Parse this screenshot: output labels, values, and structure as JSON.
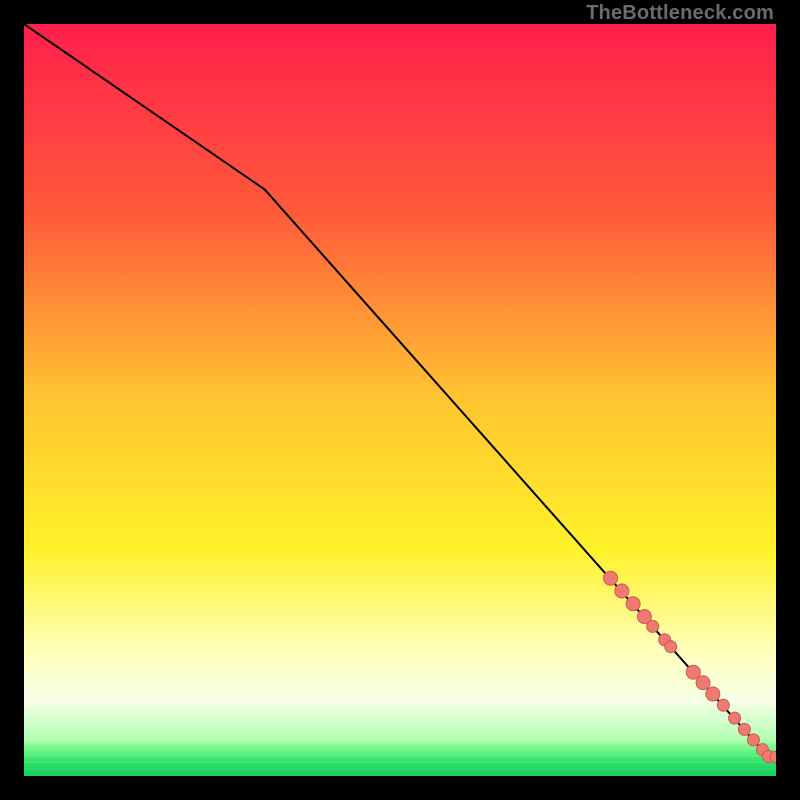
{
  "watermark": "TheBottleneck.com",
  "chart_data": {
    "type": "line",
    "title": "",
    "xlabel": "",
    "ylabel": "",
    "xlim": [
      0,
      100
    ],
    "ylim": [
      0,
      100
    ],
    "grid": false,
    "background_gradient": {
      "stops": [
        {
          "pos": 0.0,
          "color": "#ff1f4c"
        },
        {
          "pos": 0.25,
          "color": "#ff5a3a"
        },
        {
          "pos": 0.5,
          "color": "#ffc531"
        },
        {
          "pos": 0.7,
          "color": "#fff22a"
        },
        {
          "pos": 0.83,
          "color": "#ffffb8"
        },
        {
          "pos": 0.9,
          "color": "#f8ffe8"
        },
        {
          "pos": 0.95,
          "color": "#b4ffb6"
        },
        {
          "pos": 1.0,
          "color": "#00e05a"
        }
      ],
      "green_band": [
        {
          "pos": 0.955,
          "color": "#9cff9e"
        },
        {
          "pos": 0.965,
          "color": "#6cf686"
        },
        {
          "pos": 0.978,
          "color": "#3ce46f"
        },
        {
          "pos": 0.99,
          "color": "#21d862"
        },
        {
          "pos": 1.0,
          "color": "#14cf5a"
        }
      ]
    },
    "series": [
      {
        "name": "curve",
        "type": "line",
        "color": "#000000",
        "x": [
          0.0,
          32.0,
          99.0,
          100.0
        ],
        "y": [
          100.0,
          78.0,
          2.5,
          2.5
        ]
      },
      {
        "name": "highlight-dots",
        "type": "scatter",
        "color_fill": "#ee7a71",
        "color_stroke": "#cc5a52",
        "points": [
          {
            "x": 78.0,
            "y": 26.3,
            "r": 7
          },
          {
            "x": 79.5,
            "y": 24.6,
            "r": 7
          },
          {
            "x": 81.0,
            "y": 22.9,
            "r": 7
          },
          {
            "x": 82.5,
            "y": 21.2,
            "r": 7
          },
          {
            "x": 83.6,
            "y": 19.9,
            "r": 6
          },
          {
            "x": 85.2,
            "y": 18.1,
            "r": 6
          },
          {
            "x": 86.0,
            "y": 17.2,
            "r": 6
          },
          {
            "x": 89.0,
            "y": 13.8,
            "r": 7
          },
          {
            "x": 90.3,
            "y": 12.4,
            "r": 7
          },
          {
            "x": 91.6,
            "y": 10.9,
            "r": 7
          },
          {
            "x": 93.0,
            "y": 9.4,
            "r": 6
          },
          {
            "x": 94.5,
            "y": 7.7,
            "r": 6
          },
          {
            "x": 95.8,
            "y": 6.2,
            "r": 6
          },
          {
            "x": 97.0,
            "y": 4.8,
            "r": 6
          },
          {
            "x": 98.2,
            "y": 3.5,
            "r": 6
          },
          {
            "x": 99.0,
            "y": 2.6,
            "r": 6
          },
          {
            "x": 100.0,
            "y": 2.5,
            "r": 6
          }
        ]
      }
    ]
  }
}
